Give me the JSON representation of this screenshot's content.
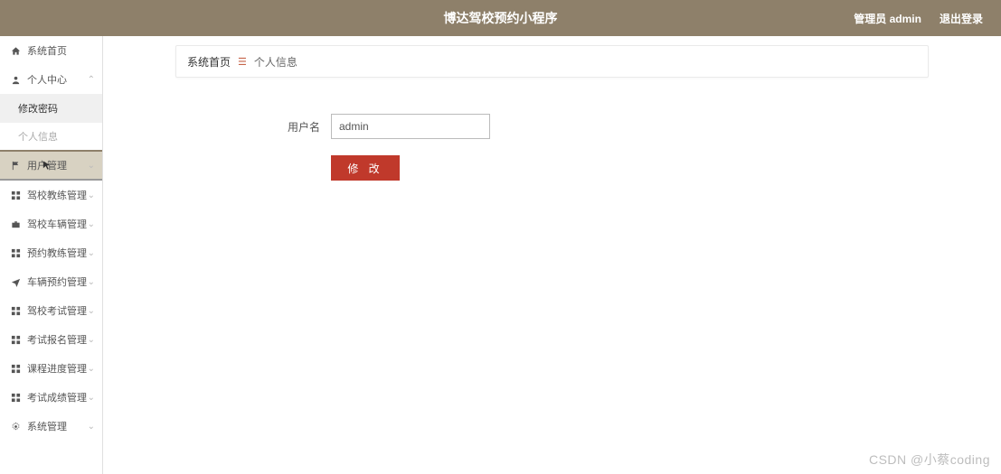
{
  "header": {
    "title": "博达驾校预约小程序",
    "admin_label": "管理员 admin",
    "logout_label": "退出登录"
  },
  "sidebar": {
    "home": {
      "label": "系统首页"
    },
    "personal": {
      "label": "个人中心",
      "children": {
        "pwd": "修改密码",
        "info": "个人信息"
      }
    },
    "user": {
      "label": "用户管理"
    },
    "coach": {
      "label": "驾校教练管理"
    },
    "vehicle": {
      "label": "驾校车辆管理"
    },
    "reserve_coach": {
      "label": "预约教练管理"
    },
    "reserve_vehicle": {
      "label": "车辆预约管理"
    },
    "exam": {
      "label": "驾校考试管理"
    },
    "signup": {
      "label": "考试报名管理"
    },
    "course": {
      "label": "课程进度管理"
    },
    "score": {
      "label": "考试成绩管理"
    },
    "system": {
      "label": "系统管理"
    }
  },
  "breadcrumb": {
    "root": "系统首页",
    "current": "个人信息"
  },
  "form": {
    "username_label": "用户名",
    "username_value": "admin",
    "submit_label": "修 改"
  },
  "watermark": "CSDN @小蔡coding"
}
